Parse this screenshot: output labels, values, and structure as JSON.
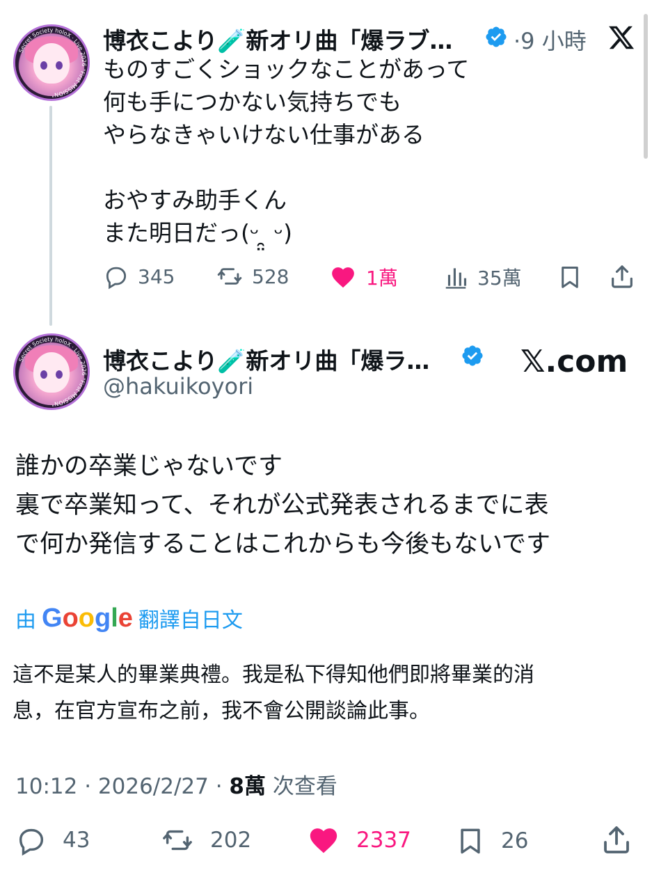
{
  "reply": {
    "display_name": "博衣こより🧪新オリ曲「爆ラブ…",
    "time": "·9 小時",
    "lines": "ものすごくショックなことがあって\n何も手につかない気持ちでも\nやらなきゃいけない仕事がある\n\nおやすみ助手くん\nまた明日だっ(ᵕ ̯̤ ᵕ)",
    "actions": {
      "replies": "345",
      "reposts": "528",
      "likes": "1萬",
      "views": "35萬"
    }
  },
  "main": {
    "display_name": "博衣こより🧪新オリ曲「爆ラ…",
    "handle": "@hakuikoyori",
    "brand": "𝕏.com",
    "text": "誰かの卒業じゃないです\n裏で卒業知って、それが公式発表されるまでに表\nで何か発信することはこれからも今後もないです",
    "translation_prefix": "由",
    "translation_brand": "Google",
    "translation_suffix": "翻譯自日文",
    "translated_text": "這不是某人的畢業典禮。我是私下得知他們即將畢業的消\n息，在官方宣布之前，我不會公開談論此事。",
    "timestamp": "10:12 · 2026/2/27 · ",
    "views_count": "8萬",
    "views_label": " 次查看",
    "actions": {
      "replies": "43",
      "reposts": "202",
      "likes": "2337",
      "bookmarks": "26"
    }
  },
  "colors": {
    "like": "#f91880",
    "verified": "#1d9bf0",
    "muted": "#536471",
    "google_blue": "#4285f4"
  },
  "avatar_text": "Secret Society holoX · Live 2026 \"First MISSION\""
}
